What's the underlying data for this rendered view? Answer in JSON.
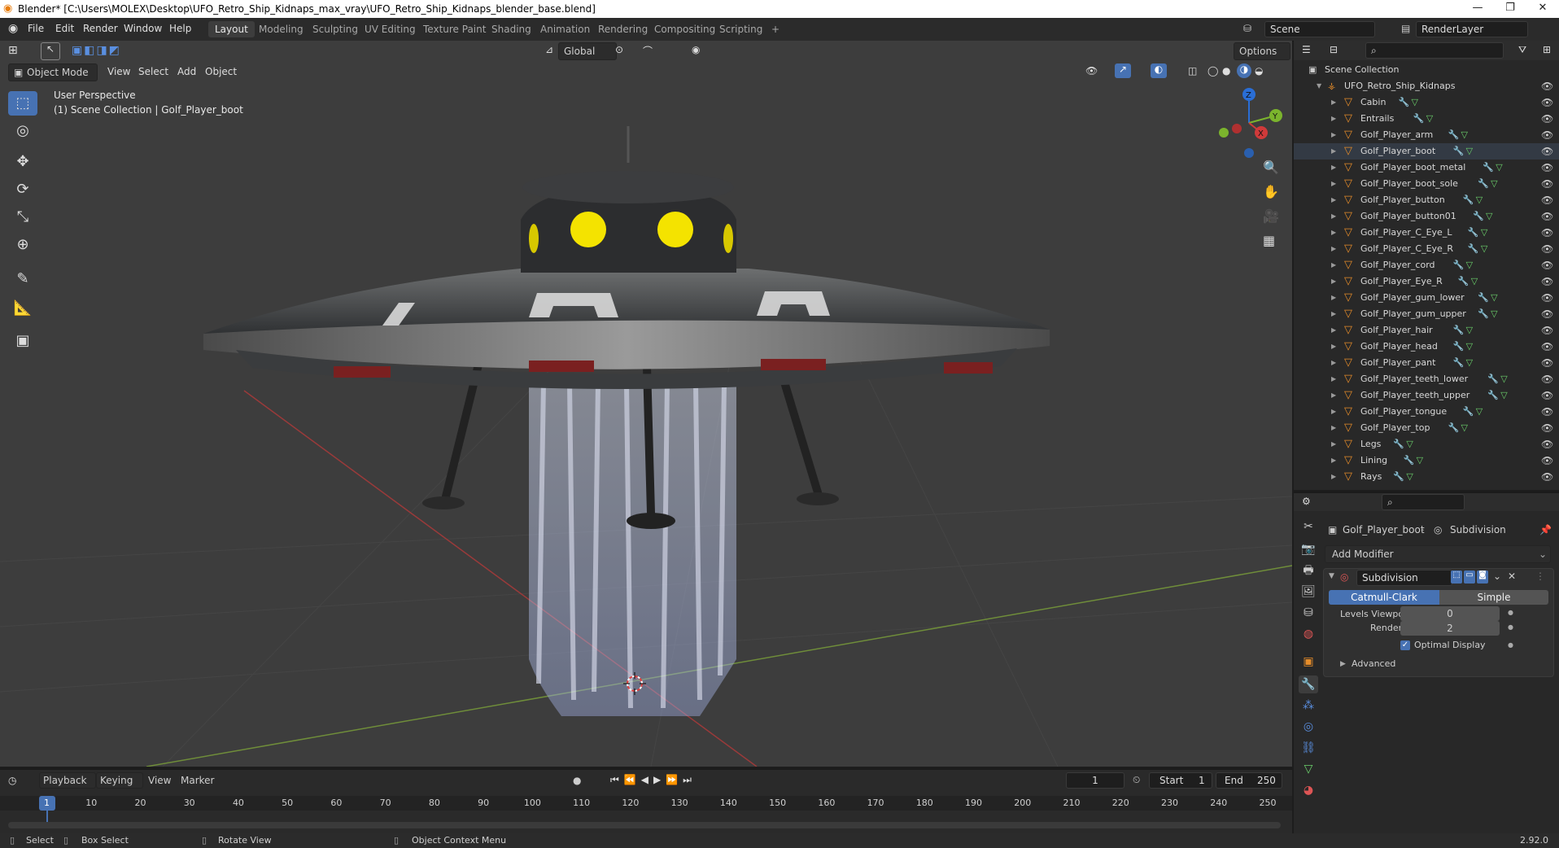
{
  "window": {
    "title": "Blender* [C:\\Users\\MOLEX\\Desktop\\UFO_Retro_Ship_Kidnaps_max_vray\\UFO_Retro_Ship_Kidnaps_blender_base.blend]",
    "minimize": "—",
    "maximize": "❐",
    "close": "✕"
  },
  "menu": {
    "items": [
      "File",
      "Edit",
      "Render",
      "Window",
      "Help"
    ]
  },
  "workspaces": {
    "tabs": [
      "Layout",
      "Modeling",
      "Sculpting",
      "UV Editing",
      "Texture Paint",
      "Shading",
      "Animation",
      "Rendering",
      "Compositing",
      "Scripting"
    ],
    "active": "Layout",
    "add": "+"
  },
  "scene": {
    "name": "Scene",
    "render_layer": "RenderLayer"
  },
  "viewport": {
    "mode": "Object Mode",
    "header_menus": [
      "View",
      "Select",
      "Add",
      "Object"
    ],
    "transform_orientation": "Global",
    "options_label": "Options",
    "overlay_line1": "User Perspective",
    "overlay_line2": "(1) Scene Collection | Golf_Player_boot",
    "gizmo": {
      "z": "Z",
      "y": "Y",
      "x": "X"
    }
  },
  "outliner": {
    "root": "Scene Collection",
    "collection": "UFO_Retro_Ship_Kidnaps",
    "objects": [
      "Cabin",
      "Entrails",
      "Golf_Player_arm",
      "Golf_Player_boot",
      "Golf_Player_boot_metal",
      "Golf_Player_boot_sole",
      "Golf_Player_button",
      "Golf_Player_button01",
      "Golf_Player_C_Eye_L",
      "Golf_Player_C_Eye_R",
      "Golf_Player_cord",
      "Golf_Player_Eye_R",
      "Golf_Player_gum_lower",
      "Golf_Player_gum_upper",
      "Golf_Player_hair",
      "Golf_Player_head",
      "Golf_Player_pant",
      "Golf_Player_teeth_lower",
      "Golf_Player_teeth_upper",
      "Golf_Player_tongue",
      "Golf_Player_top",
      "Legs",
      "Lining",
      "Rays"
    ],
    "selected": "Golf_Player_boot"
  },
  "properties": {
    "object_name": "Golf_Player_boot",
    "modifier_crumb": "Subdivision",
    "add_modifier": "Add Modifier",
    "modifier": {
      "name": "Subdivision",
      "type_a": "Catmull-Clark",
      "type_b": "Simple",
      "levels_viewport_label": "Levels Viewport",
      "levels_viewport": "0",
      "render_label": "Render",
      "render": "2",
      "optimal_display_label": "Optimal Display",
      "optimal_display": true,
      "advanced_label": "Advanced"
    }
  },
  "timeline": {
    "menus": [
      "Playback",
      "Keying",
      "View",
      "Marker"
    ],
    "current_frame": "1",
    "start_label": "Start",
    "start": "1",
    "end_label": "End",
    "end": "250",
    "ticks": [
      "1",
      "10",
      "20",
      "30",
      "40",
      "50",
      "60",
      "70",
      "80",
      "90",
      "100",
      "110",
      "120",
      "130",
      "140",
      "150",
      "160",
      "170",
      "180",
      "190",
      "200",
      "210",
      "220",
      "230",
      "240",
      "250"
    ]
  },
  "statusbar": {
    "select": "Select",
    "box_select": "Box Select",
    "rotate_view": "Rotate View",
    "context_menu": "Object Context Menu",
    "version": "2.92.0"
  },
  "colors": {
    "accent": "#4772b3",
    "object_orange": "#e58c2a",
    "viewport_bg": "#3d3d3d",
    "panel_bg": "#282828"
  }
}
